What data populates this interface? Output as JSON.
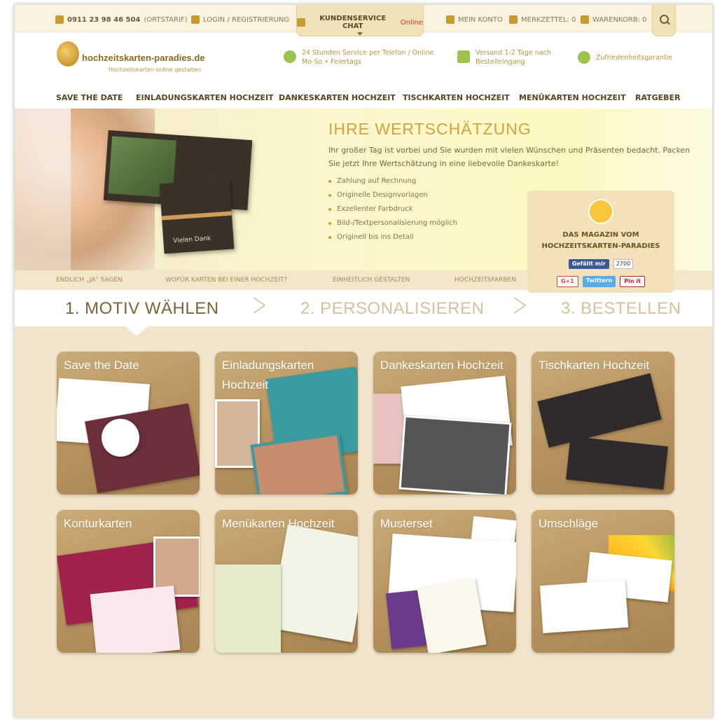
{
  "topbar": {
    "phone": "0911 23 98 46 504",
    "phone_note": "(ORTSTARIF)",
    "login": "LOGIN / REGISTRIERUNG",
    "chat": "KUNDENSERVICE CHAT",
    "chat_status": "Online",
    "account": "MEIN KONTO",
    "wishlist": "MERKZETTEL: 0",
    "cart": "WARENKORB: 0"
  },
  "header": {
    "logo_name": "hochzeitskarten-paradies.de",
    "logo_tagline": "Hochzeitskarten online gestalten",
    "usp1": [
      "24 Stunden Service per Telefon / Online",
      "Mo-So • Feiertags"
    ],
    "usp2": [
      "Versand 1-2 Tage nach",
      "Bestelleingang"
    ],
    "usp3": "Zufriedenheitsgarantie"
  },
  "nav": [
    "SAVE THE DATE",
    "EINLADUNGSKARTEN HOCHZEIT",
    "DANKESKARTEN HOCHZEIT",
    "TISCHKARTEN HOCHZEIT",
    "MENÜKARTEN HOCHZEIT",
    "RATGEBER"
  ],
  "hero": {
    "title": "IHRE WERTSCHÄTZUNG",
    "intro": "Ihr großer Tag ist vorbei und Sie wurden mit vielen Wünschen und Präsenten bedacht. Packen Sie jetzt Ihre Wertschätzung in eine liebevolle Dankeskarte!",
    "bullets": [
      "Zahlung auf Rechnung",
      "Originelle Designvorlagen",
      "Exzellenter Farbdruck",
      "Bild-/Textpersonalisierung möglich",
      "Originell bis ins Detail"
    ],
    "card_text": "Vielen Dank"
  },
  "magazin": {
    "title_line1": "DAS MAGAZIN VOM",
    "title_line2": "HOCHZEITSKARTEN-PARADIES",
    "fb_like": "Gefällt mir",
    "fb_count": "2700",
    "gplus": "G+1",
    "twitter": "Twittern",
    "pinterest": "Pin it"
  },
  "subnav": [
    "ENDLICH „JA\" SAGEN",
    "WOFÜR KARTEN BEI EINER HOCHZEIT?",
    "EINHEITLICH GESTALTEN",
    "HOCHZEITSFARBEN"
  ],
  "steps": [
    "1. MOTIV WÄHLEN",
    "2. PERSONALISIEREN",
    "3. BESTELLEN"
  ],
  "tiles": [
    "Save the Date",
    "Einladungskarten Hochzeit",
    "Dankeskarten Hochzeit",
    "Tischkarten Hochzeit",
    "Konturkarten",
    "Menükarten Hochzeit",
    "Musterset",
    "Umschläge"
  ],
  "colors": {
    "accent": "#c89a2e",
    "status_online": "#d9342b",
    "tile_wood": "#b8935f"
  }
}
